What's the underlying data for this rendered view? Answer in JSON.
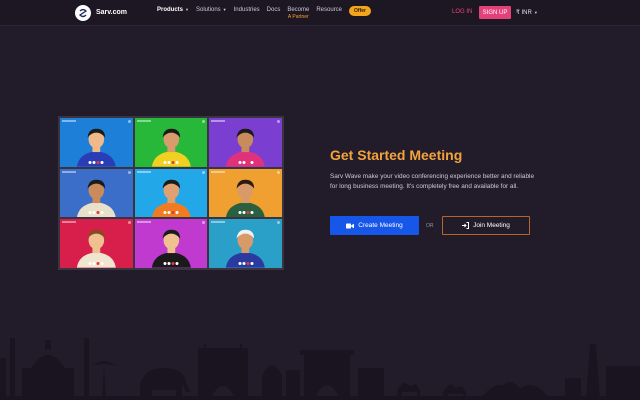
{
  "header": {
    "logo_text": "Sarv.com",
    "menu": [
      {
        "label": "Products",
        "caret": true,
        "active": true
      },
      {
        "label": "Solutions",
        "caret": true
      },
      {
        "label": "Industries"
      },
      {
        "label": "Docs"
      }
    ],
    "become": {
      "line1": "Become",
      "line2": "A Partner"
    },
    "resource": "Resource",
    "offer": "Offer",
    "login": "LOG IN",
    "signup": "SIGN UP",
    "currency": "₹ INR"
  },
  "hero": {
    "title": "Get Started Meeting",
    "description": "Sarv Wave make your video conferencing experience better and reliable for long business meeting. It's completely free and available for all.",
    "create_button": "Create Meeting",
    "or_text": "OR",
    "join_button": "Join Meeting"
  },
  "video_tiles": [
    {
      "bg": "#1e7fd8",
      "shirt": "#2a3db8",
      "hair": "#1b1b1b",
      "skin": "#f0b98a"
    },
    {
      "bg": "#27b83a",
      "shirt": "#f0d020",
      "hair": "#1b1b1b",
      "skin": "#d99a6c"
    },
    {
      "bg": "#7a3fd0",
      "shirt": "#e0327c",
      "hair": "#1b1b1b",
      "skin": "#c98a5c"
    },
    {
      "bg": "#3a6ec8",
      "shirt": "#e8e0c8",
      "hair": "#1b1b1b",
      "skin": "#c98a5c"
    },
    {
      "bg": "#22a8e8",
      "shirt": "#f07b20",
      "hair": "#1b1b1b",
      "skin": "#e0a070"
    },
    {
      "bg": "#f0a030",
      "shirt": "#2a6040",
      "hair": "#2a1a10",
      "skin": "#d89a68"
    },
    {
      "bg": "#d81e4a",
      "shirt": "#f0e6d0",
      "hair": "#8a4a20",
      "skin": "#f0c090"
    },
    {
      "bg": "#c03ad0",
      "shirt": "#1a1a1a",
      "hair": "#1b1b1b",
      "skin": "#f0c090"
    },
    {
      "bg": "#2aa0c8",
      "shirt": "#2a3aa0",
      "hair": "#f0f0f0",
      "skin": "#d89a68"
    }
  ]
}
